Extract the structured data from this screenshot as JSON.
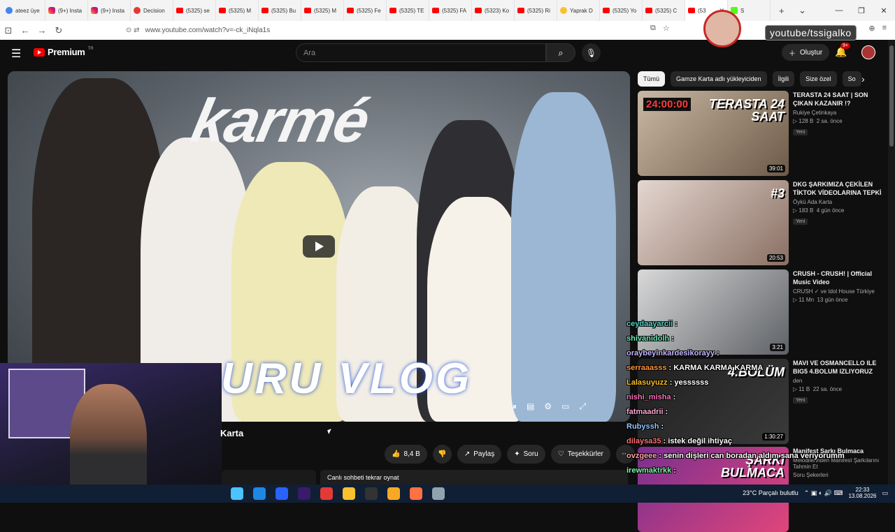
{
  "browser": {
    "tabs": [
      {
        "label": "ateez üye",
        "fav": "g"
      },
      {
        "label": "(9+) Insta",
        "fav": "ig"
      },
      {
        "label": "(9+) Insta",
        "fav": "ig"
      },
      {
        "label": "Decision",
        "fav": "d"
      },
      {
        "label": "(5325) se",
        "fav": "yt"
      },
      {
        "label": "(5325) M",
        "fav": "yt"
      },
      {
        "label": "(5325) Bu",
        "fav": "yt"
      },
      {
        "label": "(5325) M",
        "fav": "yt"
      },
      {
        "label": "(5325) Fe",
        "fav": "yt"
      },
      {
        "label": "(5325) TE",
        "fav": "yt"
      },
      {
        "label": "(5325) FA",
        "fav": "yt"
      },
      {
        "label": "(5323) Ko",
        "fav": "yt"
      },
      {
        "label": "(5325) Ri",
        "fav": "yt"
      },
      {
        "label": "Yaprak D",
        "fav": "y"
      },
      {
        "label": "(5325) Yo",
        "fav": "yt"
      },
      {
        "label": "(5325) C",
        "fav": "yt"
      },
      {
        "label": "(53",
        "fav": "yt",
        "active": true
      },
      {
        "label": "S",
        "fav": "k"
      }
    ],
    "url": "www.youtube.com/watch?v=-ck_iNqla1s"
  },
  "youtube": {
    "logo": "Premium",
    "region": "TR",
    "search_placeholder": "Ara",
    "create_label": "Oluştur",
    "notif_badge": "9+"
  },
  "video": {
    "title_fragment": "Karta",
    "thumb_brand": "karmé",
    "thumb_big_text": "URU VLOG",
    "like_count": "8,4 B",
    "share_label": "Paylaş",
    "ask_label": "Soru",
    "thanks_label": "Teşekkürler",
    "replay_chat": "Canlı sohbeti tekrar oynat"
  },
  "chips": [
    {
      "label": "Tümü",
      "active": true
    },
    {
      "label": "Gamze Karta adlı yükleyiciden"
    },
    {
      "label": "İlgili"
    },
    {
      "label": "Size özel"
    },
    {
      "label": "So"
    }
  ],
  "recommendations": [
    {
      "title": "TERASTA 24 SAAT | SON ÇIKAN KAZANIR !?",
      "channel": "Rukiye Çetinkaya",
      "views": "128 B",
      "age": "2 sa. önce",
      "tag": "Yeni",
      "duration": "39:01",
      "thumb_text": "TERASTA 24 SAAT",
      "thumb_timer": "24:00:00"
    },
    {
      "title": "DKG ŞARKIMIZA ÇEKİLEN TİKTOK VİDEOLARINA TEPKİ VERDİK !? | Gamze Karta ...",
      "channel": "Öykü Ada Karta",
      "views": "183 B",
      "age": "4 gün önce",
      "tag": "Yeni",
      "duration": "20:53",
      "thumb_text": "#3"
    },
    {
      "title": "CRUSH - CRUSH! | Official Music Video",
      "channel": "CRUSH",
      "channel_extra": "ve Idol House Türkiye",
      "views": "11 Mn",
      "age": "13 gün önce",
      "duration": "3:21"
    },
    {
      "title": "MAVI VE OSMANCELLO ILE BIG5 4.BOLUM IZLIYORUZ",
      "channel": "den",
      "views": "11 B",
      "age": "22 sa. önce",
      "tag": "Yeni",
      "duration": "1:30:27",
      "thumb_text": "4.BÖLÜM"
    },
    {
      "title": "Manifest Şarkı Bulmaca",
      "channel": "Soru Şekerleri",
      "thumb_text": "ŞARKI BULMACA",
      "subtitle": "Melodilerinden Manifest Şarkılarını Tahmin Et"
    }
  ],
  "chat": [
    {
      "user": "ceydaayarcii",
      "msg": ":",
      "color": "#4fd1c5"
    },
    {
      "user": "shivanidolh",
      "msg": ":",
      "color": "#6ee7b7"
    },
    {
      "user": "oraybeyinkardesikorayy",
      "msg": ":",
      "color": "#c4b5fd"
    },
    {
      "user": "serraaasss",
      "msg": ": KARMA KARMA KARMA",
      "color": "#fb923c"
    },
    {
      "user": "Lalasuyuzz",
      "msg": ": yessssss",
      "color": "#fbbf24"
    },
    {
      "user": "nishi_misha",
      "msg": ":",
      "color": "#f472b6"
    },
    {
      "user": "fatmaadrii",
      "msg": ":",
      "color": "#f9a8d4"
    },
    {
      "user": "Rubyssh",
      "msg": ":",
      "color": "#93c5fd"
    },
    {
      "user": "dilaysa35",
      "msg": ": istek değil ihtiyaç",
      "color": "#f87171"
    },
    {
      "user": "ovzgeee",
      "msg": ": senin dişleri can boradan aldım sana veriyorumm",
      "color": "#fca5a5"
    },
    {
      "user": "irewmaktrkk",
      "msg": ":",
      "color": "#86efac"
    }
  ],
  "overlay": {
    "handle": "youtube/tssigalko"
  },
  "taskbar": {
    "weather": "23°C  Parçalı bulutlu",
    "time": "22:33",
    "date": "13.08.2026",
    "icons": [
      "windows",
      "edge",
      "bluetooth",
      "premiere",
      "opera",
      "chrome",
      "obs",
      "explorer",
      "firefox",
      "app"
    ]
  }
}
